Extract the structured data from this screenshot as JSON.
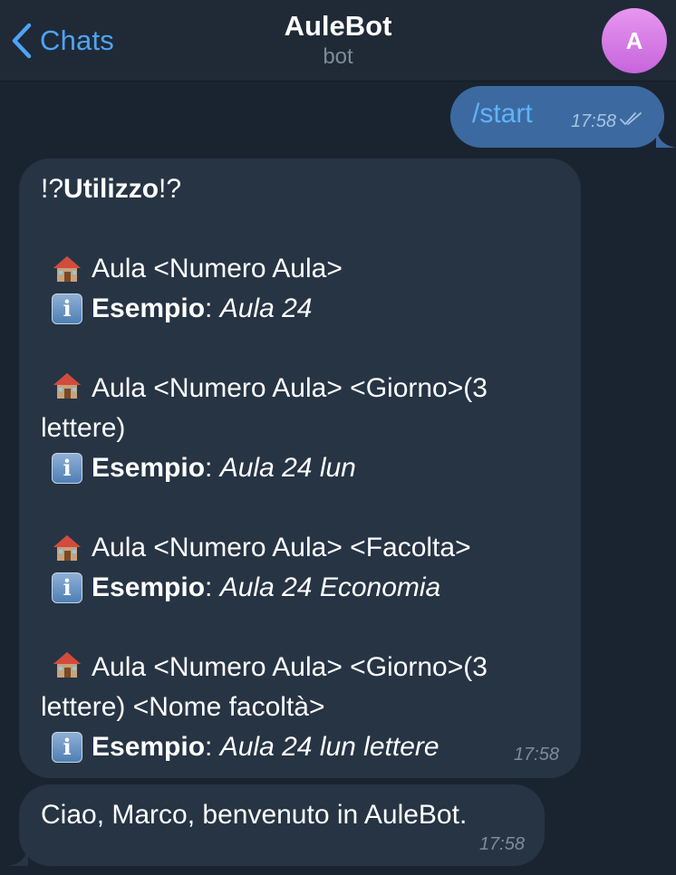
{
  "header": {
    "back_label": "Chats",
    "title": "AuleBot",
    "subtitle": "bot",
    "avatar_letter": "A"
  },
  "messages": {
    "outgoing": {
      "text": "/start",
      "time": "17:58",
      "status": "read"
    },
    "help": {
      "heading_prefix": "!?",
      "heading": "Utilizzo",
      "heading_suffix": "!?",
      "example_label": "Esempio",
      "example_colon": ":",
      "time": "17:58",
      "items": [
        {
          "syntax": "Aula <Numero Aula>",
          "example": "Aula 24"
        },
        {
          "syntax": "Aula <Numero Aula> <Giorno>(3 lettere)",
          "example": "Aula 24 lun"
        },
        {
          "syntax": "Aula <Numero Aula> <Facolta>",
          "example": "Aula 24 Economia"
        },
        {
          "syntax": "Aula <Numero Aula> <Giorno>(3 lettere) <Nome facoltà>",
          "example": "Aula 24 lun lettere"
        }
      ]
    },
    "welcome": {
      "text": "Ciao, Marco, benvenuto in AuleBot.",
      "time": "17:58"
    }
  },
  "icons": {
    "back": "chevron-left-icon",
    "house": "house-icon",
    "info": "info-icon",
    "read": "double-check-icon"
  },
  "colors": {
    "background": "#1a2430",
    "header": "#1f2a36",
    "incoming_bubble": "#263444",
    "outgoing_bubble": "#3c6aa0",
    "accent": "#4ea4f6"
  }
}
